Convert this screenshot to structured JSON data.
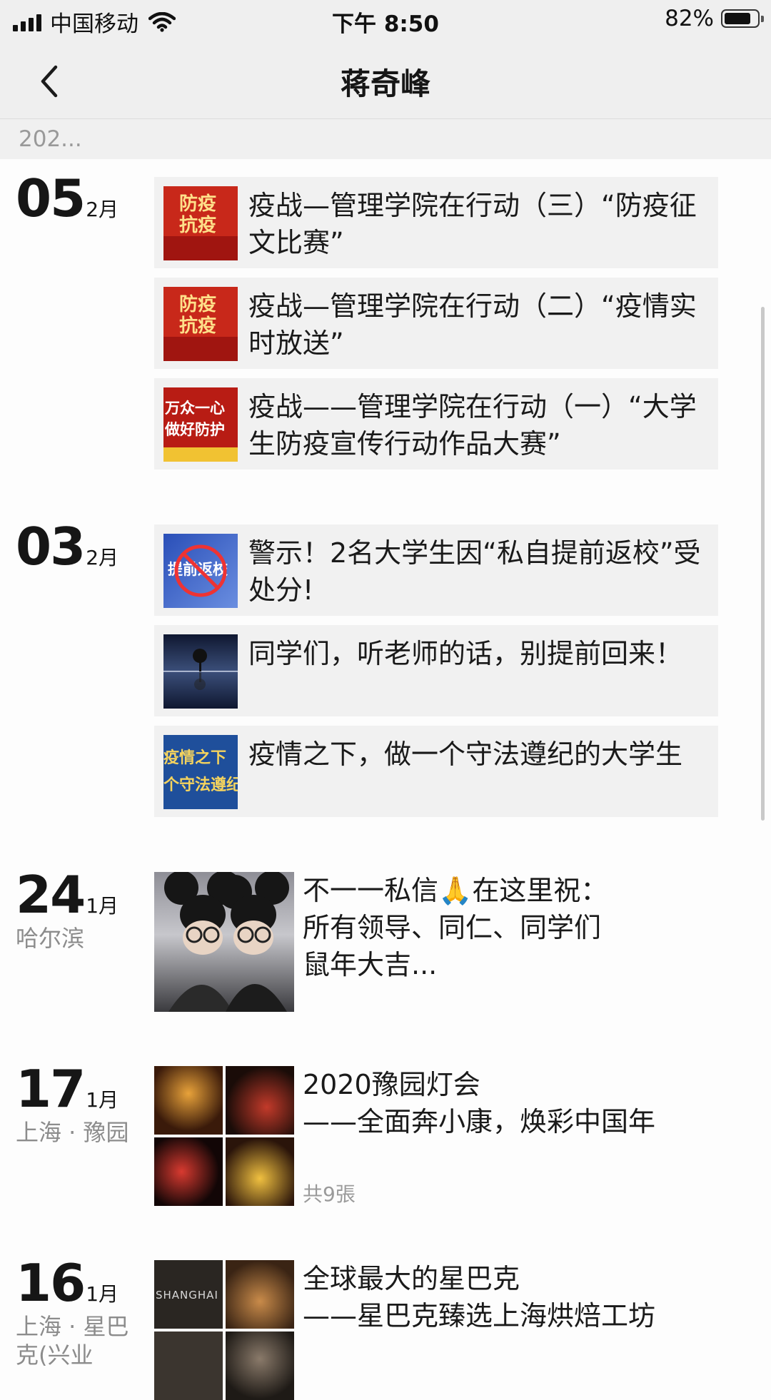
{
  "status_bar": {
    "carrier": "中国移动",
    "time": "下午 8:50",
    "battery_text": "82%",
    "battery_level": 0.82
  },
  "header": {
    "title": "蒋奇峰",
    "back_icon": "chevron-left-icon"
  },
  "year_label": "202...",
  "entries": [
    {
      "day": "05",
      "month": "2月",
      "articles": [
        {
          "title": "疫战—管理学院在行动（三）“防疫征文比赛”",
          "thumb_text": "防疫\n抗疫"
        },
        {
          "title": "疫战—管理学院在行动（二）“疫情实时放送”",
          "thumb_text": "防疫\n抗疫"
        },
        {
          "title": "疫战——管理学院在行动（一）“大学生防疫宣传行动作品大赛”",
          "thumb_text": "万众一心\n做好防护"
        }
      ]
    },
    {
      "day": "03",
      "month": "2月",
      "articles": [
        {
          "title": "警示！2名大学生因“私自提前返校”受处分!",
          "thumb_text": "提前返校"
        },
        {
          "title": "同学们，听老师的话，别提前回来！",
          "thumb_text": ""
        },
        {
          "title": "疫情之下，做一个守法遵纪的大学生",
          "thumb_text": "疫情之下\n个守法遵纪大"
        }
      ]
    },
    {
      "day": "24",
      "month": "1月",
      "location": "哈尔滨",
      "post_text": "不一一私信🙏在这里祝：\n所有领导、同仁、同学们\n鼠年大吉..."
    },
    {
      "day": "17",
      "month": "1月",
      "location": "上海 · 豫园",
      "post_text": "2020豫园灯会\n——全面奔小康，焕彩中国年",
      "photo_count": "共9張"
    },
    {
      "day": "16",
      "month": "1月",
      "location": "上海 · 星巴克(兴业",
      "post_text": "全球最大的星巴克\n——星巴克臻选上海烘焙工坊",
      "thumb_text": "SHANGHAI"
    }
  ]
}
